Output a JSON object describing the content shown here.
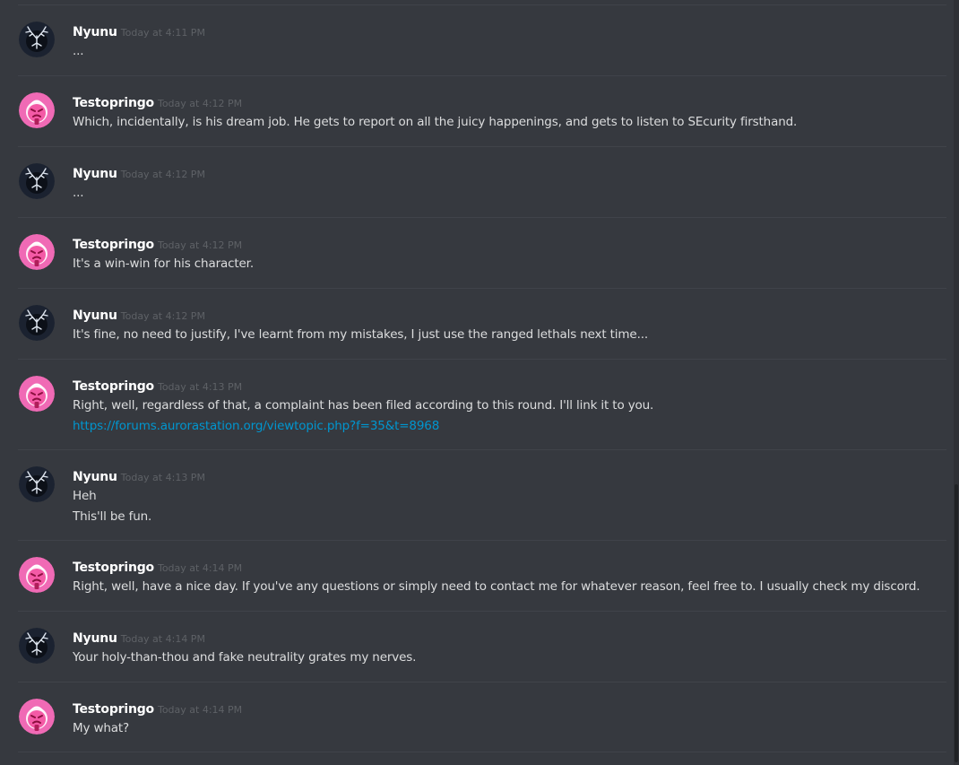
{
  "users": {
    "nyunu": {
      "name": "Nyunu",
      "avatar_icon": "dark-antler-avatar-icon",
      "avatar_color": "#1b2230"
    },
    "testopringo": {
      "name": "Testopringo",
      "avatar_icon": "pink-face-avatar-icon",
      "avatar_color": "#f06ab5"
    }
  },
  "messages": [
    {
      "author": "Nyunu",
      "avatar": "nyunu",
      "timestamp": "Today at 4:11 PM",
      "lines": [
        "..."
      ]
    },
    {
      "author": "Testopringo",
      "avatar": "testopringo",
      "timestamp": "Today at 4:12 PM",
      "lines": [
        "Which, incidentally, is his dream job. He gets to report on all the juicy happenings, and gets to listen to SEcurity firsthand."
      ]
    },
    {
      "author": "Nyunu",
      "avatar": "nyunu",
      "timestamp": "Today at 4:12 PM",
      "lines": [
        "..."
      ]
    },
    {
      "author": "Testopringo",
      "avatar": "testopringo",
      "timestamp": "Today at 4:12 PM",
      "lines": [
        "It's a win-win for his character."
      ]
    },
    {
      "author": "Nyunu",
      "avatar": "nyunu",
      "timestamp": "Today at 4:12 PM",
      "lines": [
        "It's fine, no need to justify, I've learnt from my mistakes, I just use the ranged lethals next time..."
      ]
    },
    {
      "author": "Testopringo",
      "avatar": "testopringo",
      "timestamp": "Today at 4:13 PM",
      "lines": [
        "Right, well, regardless of that, a complaint has been filed according to this round. I'll link it to you."
      ],
      "link": "https://forums.aurorastation.org/viewtopic.php?f=35&t=8968"
    },
    {
      "author": "Nyunu",
      "avatar": "nyunu",
      "timestamp": "Today at 4:13 PM",
      "lines": [
        "Heh",
        "This'll be fun."
      ]
    },
    {
      "author": "Testopringo",
      "avatar": "testopringo",
      "timestamp": "Today at 4:14 PM",
      "lines": [
        "Right, well, have a nice day. If you've any questions or simply need to contact me for whatever reason, feel free to. I usually check my discord."
      ]
    },
    {
      "author": "Nyunu",
      "avatar": "nyunu",
      "timestamp": "Today at 4:14 PM",
      "lines": [
        "Your holy-than-thou and fake neutrality grates my nerves."
      ]
    },
    {
      "author": "Testopringo",
      "avatar": "testopringo",
      "timestamp": "Today at 4:14 PM",
      "lines": [
        "My what?"
      ]
    }
  ],
  "colors": {
    "background": "#36393f",
    "divider": "#40434a",
    "author": "#ffffff",
    "timestamp": "#5e6166",
    "text": "#dcddde",
    "link": "#0096cf",
    "scrollbar_track": "#2f3136",
    "scrollbar_thumb": "#202225"
  }
}
